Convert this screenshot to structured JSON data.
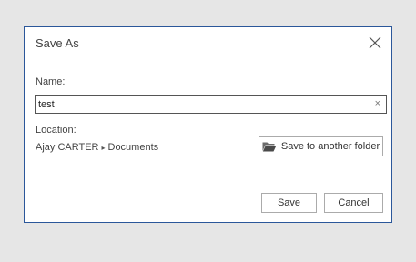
{
  "dialog": {
    "title": "Save As",
    "name_label": "Name:",
    "name_value": "test",
    "clear_glyph": "×",
    "location_label": "Location:",
    "location_path": {
      "user": "Ajay CARTER",
      "separator": "▸",
      "folder": "Documents"
    },
    "save_another_label": "Save to another folder",
    "save_label": "Save",
    "cancel_label": "Cancel"
  },
  "colors": {
    "accent_border": "#2b579a",
    "backdrop": "#e6e6e6"
  },
  "icons": {
    "close": "close-icon",
    "folder": "folder-open-icon",
    "clear": "clear-icon"
  }
}
